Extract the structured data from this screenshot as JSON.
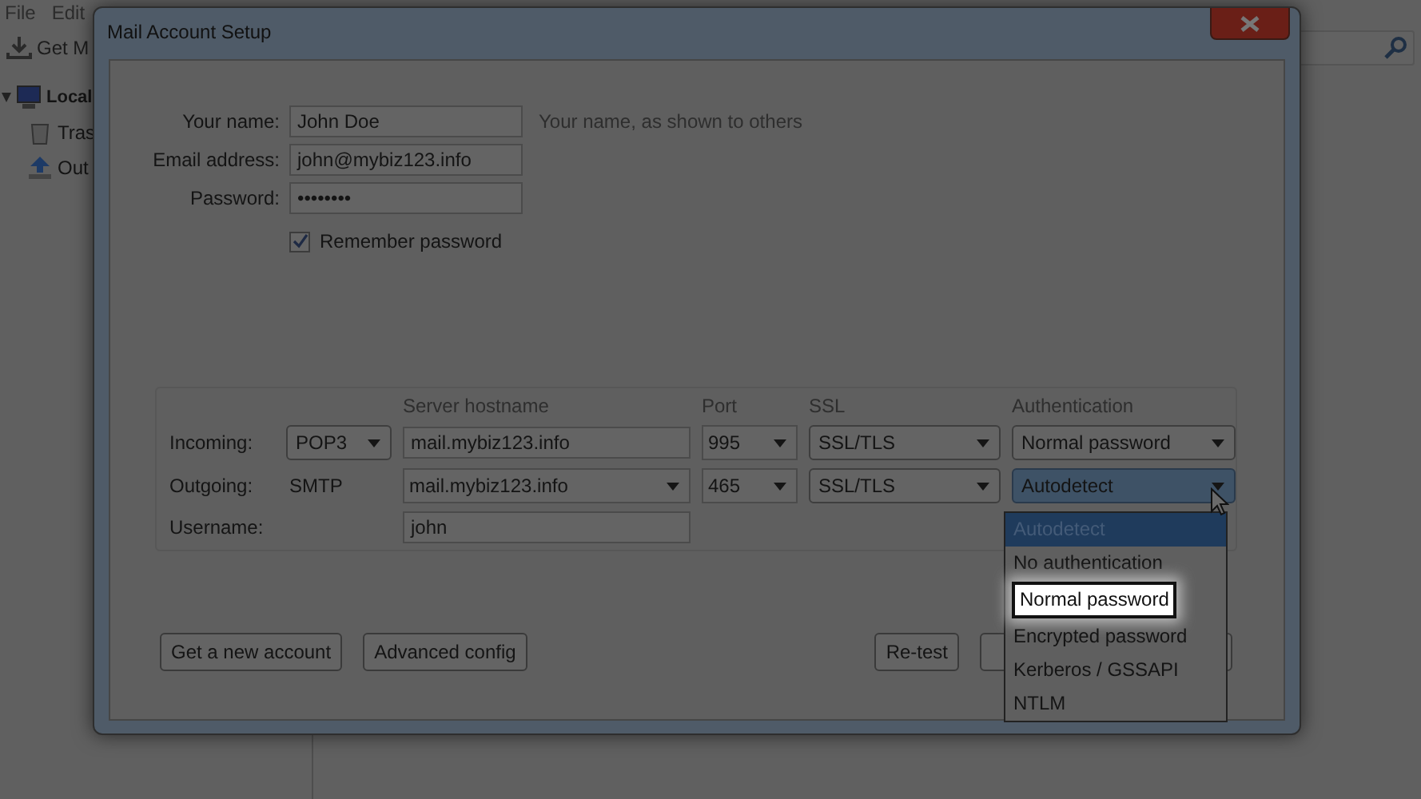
{
  "app": {
    "menu": [
      "File",
      "Edit"
    ],
    "toolbar_button": "Get M",
    "folders": [
      {
        "label": "Local",
        "expanded": true,
        "children": [
          {
            "label": "Tras"
          },
          {
            "label": "Out"
          }
        ]
      }
    ]
  },
  "dialog": {
    "title": "Mail Account Setup",
    "fields": [
      {
        "label": "Your name:",
        "value": "John Doe",
        "hint": "Your name, as shown to others"
      },
      {
        "label": "Email address:",
        "value": "john@mybiz123.info"
      },
      {
        "label": "Password:",
        "value": "••••••••"
      }
    ],
    "remember": {
      "label": "Remember password",
      "checked": true
    },
    "server": {
      "columns": [
        "Server hostname",
        "Port",
        "SSL",
        "Authentication"
      ],
      "rows": [
        {
          "label": "Incoming:",
          "type": "POP3",
          "type_dropdown": true,
          "hostname": "mail.mybiz123.info",
          "hostname_dropdown": false,
          "port": "995",
          "ssl": "SSL/TLS",
          "auth": "Normal password",
          "open": false
        },
        {
          "label": "Outgoing:",
          "type": "SMTP",
          "type_dropdown": false,
          "hostname": "mail.mybiz123.info",
          "hostname_dropdown": true,
          "port": "465",
          "ssl": "SSL/TLS",
          "auth": "Autodetect",
          "open": true
        }
      ],
      "username_label": "Username:",
      "username": "john"
    },
    "auth_options": [
      {
        "label": "Autodetect",
        "selected": true,
        "highlighted": false
      },
      {
        "label": "No authentication",
        "selected": false,
        "highlighted": false
      },
      {
        "label": "Normal password",
        "selected": false,
        "highlighted": true
      },
      {
        "label": "Encrypted password",
        "selected": false,
        "highlighted": false
      },
      {
        "label": "Kerberos / GSSAPI",
        "selected": false,
        "highlighted": false
      },
      {
        "label": "NTLM",
        "selected": false,
        "highlighted": false
      }
    ],
    "buttons_left": [
      "Get a new account",
      "Advanced config"
    ],
    "buttons_right": [
      "Re-test"
    ],
    "covered_button": true
  }
}
